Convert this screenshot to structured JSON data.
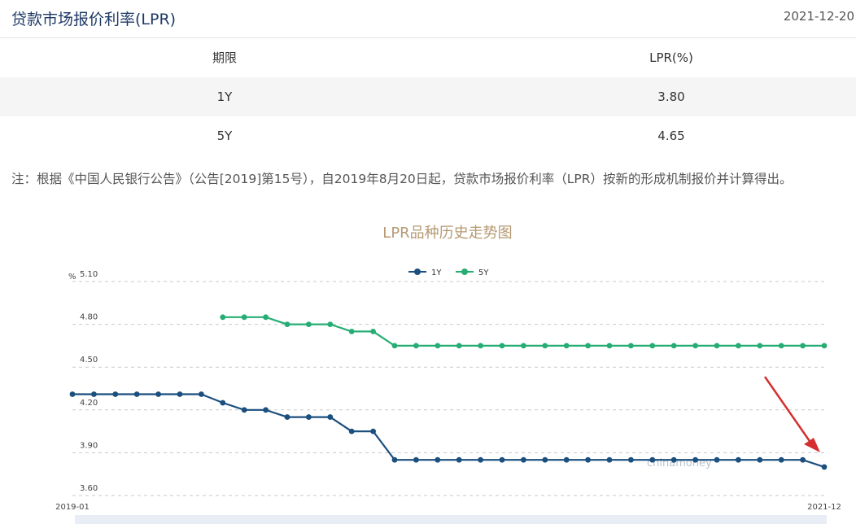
{
  "header": {
    "title": "贷款市场报价利率(LPR)",
    "date": "2021-12-20"
  },
  "table": {
    "columns": [
      "期限",
      "LPR(%)"
    ],
    "rows": [
      {
        "term": "1Y",
        "rate": "3.80"
      },
      {
        "term": "5Y",
        "rate": "4.65"
      }
    ]
  },
  "note": "注：根据《中国人民银行公告》（公告[2019]第15号），自2019年8月20日起，贷款市场报价利率（LPR）按新的形成机制报价并计算得出。",
  "watermark": "chinamoney",
  "colors": {
    "one_year": "#1b4f7e",
    "five_year": "#26ad74",
    "title": "#b59a72",
    "arrow": "#d42f2f"
  },
  "chart_data": {
    "type": "line",
    "title": "LPR品种历史走势图",
    "ylabel": "%",
    "ylim": [
      3.6,
      5.1
    ],
    "yticks": [
      "5.10",
      "4.80",
      "4.50",
      "4.20",
      "3.90",
      "3.60"
    ],
    "x_start_label": "2019-01",
    "x_end_label": "2021-12",
    "n_points": 36,
    "grid": true,
    "legend_placement": "top-center",
    "series": [
      {
        "name": "1Y",
        "color": "#1b4f7e",
        "values": [
          4.31,
          4.31,
          4.31,
          4.31,
          4.31,
          4.31,
          4.31,
          4.25,
          4.2,
          4.2,
          4.15,
          4.15,
          4.15,
          4.05,
          4.05,
          3.85,
          3.85,
          3.85,
          3.85,
          3.85,
          3.85,
          3.85,
          3.85,
          3.85,
          3.85,
          3.85,
          3.85,
          3.85,
          3.85,
          3.85,
          3.85,
          3.85,
          3.85,
          3.85,
          3.85,
          3.8
        ]
      },
      {
        "name": "5Y",
        "color": "#26ad74",
        "values": [
          null,
          null,
          null,
          null,
          null,
          null,
          null,
          4.85,
          4.85,
          4.85,
          4.8,
          4.8,
          4.8,
          4.75,
          4.75,
          4.65,
          4.65,
          4.65,
          4.65,
          4.65,
          4.65,
          4.65,
          4.65,
          4.65,
          4.65,
          4.65,
          4.65,
          4.65,
          4.65,
          4.65,
          4.65,
          4.65,
          4.65,
          4.65,
          4.65,
          4.65
        ]
      }
    ]
  }
}
